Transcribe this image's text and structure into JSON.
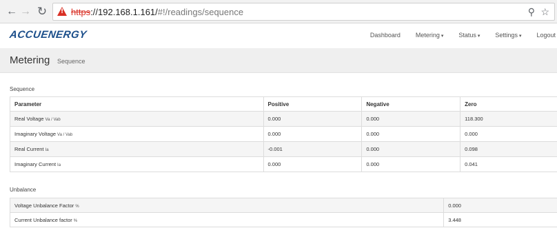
{
  "browser": {
    "url_scheme": "https",
    "url_host": "://192.168.1.161/",
    "url_path": "#!/readings/sequence",
    "icons": [
      "back-arrow-icon",
      "forward-arrow-icon",
      "reload-icon",
      "warning-icon",
      "zoom-icon",
      "star-icon"
    ]
  },
  "navbar": {
    "logo": "ACCUENERGY",
    "links": [
      {
        "label": "Dashboard",
        "has_caret": false
      },
      {
        "label": "Metering",
        "has_caret": true
      },
      {
        "label": "Status",
        "has_caret": true
      },
      {
        "label": "Settings",
        "has_caret": true
      },
      {
        "label": "Logout",
        "has_caret": false
      }
    ]
  },
  "page": {
    "title": "Metering",
    "subtitle": "Sequence"
  },
  "sequence": {
    "label": "Sequence",
    "headers": [
      "Parameter",
      "Positive",
      "Negative",
      "Zero"
    ],
    "rows": [
      {
        "param": "Real Voltage",
        "unit": "Va / Vab",
        "positive": "0.000",
        "negative": "0.000",
        "zero": "118.300"
      },
      {
        "param": "Imaginary Voltage",
        "unit": "Va / Vab",
        "positive": "0.000",
        "negative": "0.000",
        "zero": "0.000"
      },
      {
        "param": "Real Current",
        "unit": "Ia",
        "positive": "-0.001",
        "negative": "0.000",
        "zero": "0.098"
      },
      {
        "param": "Imaginary Current",
        "unit": "Ia",
        "positive": "0.000",
        "negative": "0.000",
        "zero": "0.041"
      }
    ]
  },
  "unbalance": {
    "label": "Unbalance",
    "rows": [
      {
        "param": "Voltage Unbalance Factor",
        "unit": "%",
        "value": "0.000"
      },
      {
        "param": "Current Unbalance factor",
        "unit": "%",
        "value": "3.448"
      }
    ]
  }
}
